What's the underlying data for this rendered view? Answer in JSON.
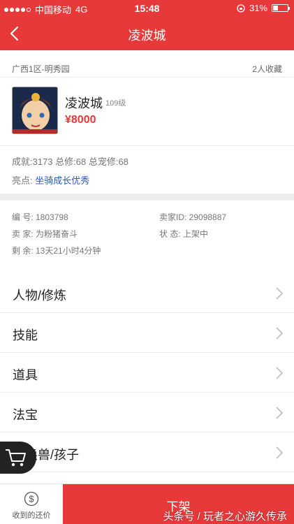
{
  "status_bar": {
    "carrier": "中国移动",
    "network": "4G",
    "time": "15:48",
    "battery": "31%"
  },
  "header": {
    "title": "凌波城"
  },
  "summary": {
    "server": "广西1区-明秀园",
    "favorites": "2人收藏",
    "name": "凌波城",
    "level": "109级",
    "price": "¥8000",
    "stats": "成就:3173  总修:68  总宠修:68",
    "highlight_label": "亮点:",
    "highlight_value": "坐骑成长优秀"
  },
  "info": {
    "id": "编   号: 1803798",
    "seller_id": "卖家ID: 29098887",
    "seller": "卖   家: 为粉猪奋斗",
    "status": "状   态: 上架中",
    "remaining": "剩   余: 13天21小时4分钟"
  },
  "menu": [
    {
      "label": "人物/修炼"
    },
    {
      "label": "技能"
    },
    {
      "label": "道具"
    },
    {
      "label": "法宝"
    },
    {
      "label": "召唤兽/孩子"
    }
  ],
  "bottom": {
    "offer_label": "收到的还价",
    "delist_label": "下架"
  },
  "watermark": "头条号 / 玩者之心游久传承",
  "colors": {
    "accent": "#e8393a",
    "link": "#2a56c6"
  }
}
